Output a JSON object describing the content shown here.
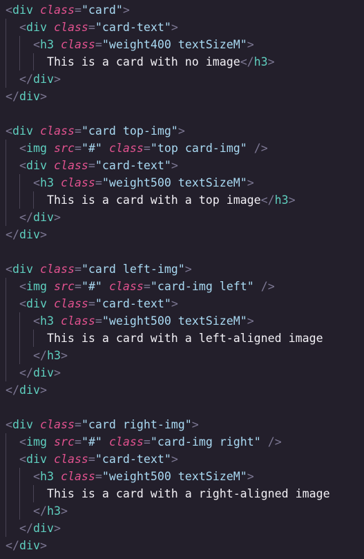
{
  "editor": {
    "colors": {
      "background": "#231f2b",
      "punctuation": "#7d7894",
      "tag": "#5fd0c0",
      "attribute": "#e2528f",
      "string": "#a9d9f2",
      "text": "#f2f0f5"
    },
    "lines": [
      {
        "indent": 0,
        "tokens": [
          [
            "punc",
            "<"
          ],
          [
            "tag",
            "div"
          ],
          [
            "txt",
            " "
          ],
          [
            "attr",
            "class"
          ],
          [
            "eq",
            "="
          ],
          [
            "str",
            "\"card\""
          ],
          [
            "punc",
            ">"
          ]
        ]
      },
      {
        "indent": 1,
        "tokens": [
          [
            "punc",
            "<"
          ],
          [
            "tag",
            "div"
          ],
          [
            "txt",
            " "
          ],
          [
            "attr",
            "class"
          ],
          [
            "eq",
            "="
          ],
          [
            "str",
            "\"card-text\""
          ],
          [
            "punc",
            ">"
          ]
        ]
      },
      {
        "indent": 2,
        "tokens": [
          [
            "punc",
            "<"
          ],
          [
            "tag",
            "h3"
          ],
          [
            "txt",
            " "
          ],
          [
            "attr",
            "class"
          ],
          [
            "eq",
            "="
          ],
          [
            "str",
            "\"weight400 textSizeM\""
          ],
          [
            "punc",
            ">"
          ]
        ]
      },
      {
        "indent": 3,
        "tokens": [
          [
            "txt",
            "This is a card with no image"
          ],
          [
            "punc",
            "</"
          ],
          [
            "tag",
            "h3"
          ],
          [
            "punc",
            ">"
          ]
        ]
      },
      {
        "indent": 1,
        "tokens": [
          [
            "punc",
            "</"
          ],
          [
            "tag",
            "div"
          ],
          [
            "punc",
            ">"
          ]
        ]
      },
      {
        "indent": 0,
        "tokens": [
          [
            "punc",
            "</"
          ],
          [
            "tag",
            "div"
          ],
          [
            "punc",
            ">"
          ]
        ]
      },
      {
        "indent": 0,
        "tokens": []
      },
      {
        "indent": 0,
        "tokens": [
          [
            "punc",
            "<"
          ],
          [
            "tag",
            "div"
          ],
          [
            "txt",
            " "
          ],
          [
            "attr",
            "class"
          ],
          [
            "eq",
            "="
          ],
          [
            "str",
            "\"card top-img\""
          ],
          [
            "punc",
            ">"
          ]
        ]
      },
      {
        "indent": 1,
        "tokens": [
          [
            "punc",
            "<"
          ],
          [
            "tag",
            "img"
          ],
          [
            "txt",
            " "
          ],
          [
            "attr",
            "src"
          ],
          [
            "eq",
            "="
          ],
          [
            "str",
            "\"#\""
          ],
          [
            "txt",
            " "
          ],
          [
            "attr",
            "class"
          ],
          [
            "eq",
            "="
          ],
          [
            "str",
            "\"top card-img\""
          ],
          [
            "txt",
            " "
          ],
          [
            "punc",
            "/>"
          ]
        ]
      },
      {
        "indent": 1,
        "tokens": [
          [
            "punc",
            "<"
          ],
          [
            "tag",
            "div"
          ],
          [
            "txt",
            " "
          ],
          [
            "attr",
            "class"
          ],
          [
            "eq",
            "="
          ],
          [
            "str",
            "\"card-text\""
          ],
          [
            "punc",
            ">"
          ]
        ]
      },
      {
        "indent": 2,
        "tokens": [
          [
            "punc",
            "<"
          ],
          [
            "tag",
            "h3"
          ],
          [
            "txt",
            " "
          ],
          [
            "attr",
            "class"
          ],
          [
            "eq",
            "="
          ],
          [
            "str",
            "\"weight500 textSizeM\""
          ],
          [
            "punc",
            ">"
          ]
        ]
      },
      {
        "indent": 3,
        "tokens": [
          [
            "txt",
            "This is a card with a top image"
          ],
          [
            "punc",
            "</"
          ],
          [
            "tag",
            "h3"
          ],
          [
            "punc",
            ">"
          ]
        ]
      },
      {
        "indent": 1,
        "tokens": [
          [
            "punc",
            "</"
          ],
          [
            "tag",
            "div"
          ],
          [
            "punc",
            ">"
          ]
        ]
      },
      {
        "indent": 0,
        "tokens": [
          [
            "punc",
            "</"
          ],
          [
            "tag",
            "div"
          ],
          [
            "punc",
            ">"
          ]
        ]
      },
      {
        "indent": 0,
        "tokens": []
      },
      {
        "indent": 0,
        "tokens": [
          [
            "punc",
            "<"
          ],
          [
            "tag",
            "div"
          ],
          [
            "txt",
            " "
          ],
          [
            "attr",
            "class"
          ],
          [
            "eq",
            "="
          ],
          [
            "str",
            "\"card left-img\""
          ],
          [
            "punc",
            ">"
          ]
        ]
      },
      {
        "indent": 1,
        "tokens": [
          [
            "punc",
            "<"
          ],
          [
            "tag",
            "img"
          ],
          [
            "txt",
            " "
          ],
          [
            "attr",
            "src"
          ],
          [
            "eq",
            "="
          ],
          [
            "str",
            "\"#\""
          ],
          [
            "txt",
            " "
          ],
          [
            "attr",
            "class"
          ],
          [
            "eq",
            "="
          ],
          [
            "str",
            "\"card-img left\""
          ],
          [
            "txt",
            " "
          ],
          [
            "punc",
            "/>"
          ]
        ]
      },
      {
        "indent": 1,
        "tokens": [
          [
            "punc",
            "<"
          ],
          [
            "tag",
            "div"
          ],
          [
            "txt",
            " "
          ],
          [
            "attr",
            "class"
          ],
          [
            "eq",
            "="
          ],
          [
            "str",
            "\"card-text\""
          ],
          [
            "punc",
            ">"
          ]
        ]
      },
      {
        "indent": 2,
        "tokens": [
          [
            "punc",
            "<"
          ],
          [
            "tag",
            "h3"
          ],
          [
            "txt",
            " "
          ],
          [
            "attr",
            "class"
          ],
          [
            "eq",
            "="
          ],
          [
            "str",
            "\"weight500 textSizeM\""
          ],
          [
            "punc",
            ">"
          ]
        ]
      },
      {
        "indent": 3,
        "tokens": [
          [
            "txt",
            "This is a card with a left-aligned image"
          ]
        ]
      },
      {
        "indent": 2,
        "tokens": [
          [
            "punc",
            "</"
          ],
          [
            "tag",
            "h3"
          ],
          [
            "punc",
            ">"
          ]
        ]
      },
      {
        "indent": 1,
        "tokens": [
          [
            "punc",
            "</"
          ],
          [
            "tag",
            "div"
          ],
          [
            "punc",
            ">"
          ]
        ]
      },
      {
        "indent": 0,
        "tokens": [
          [
            "punc",
            "</"
          ],
          [
            "tag",
            "div"
          ],
          [
            "punc",
            ">"
          ]
        ]
      },
      {
        "indent": 0,
        "tokens": []
      },
      {
        "indent": 0,
        "tokens": [
          [
            "punc",
            "<"
          ],
          [
            "tag",
            "div"
          ],
          [
            "txt",
            " "
          ],
          [
            "attr",
            "class"
          ],
          [
            "eq",
            "="
          ],
          [
            "str",
            "\"card right-img\""
          ],
          [
            "punc",
            ">"
          ]
        ]
      },
      {
        "indent": 1,
        "tokens": [
          [
            "punc",
            "<"
          ],
          [
            "tag",
            "img"
          ],
          [
            "txt",
            " "
          ],
          [
            "attr",
            "src"
          ],
          [
            "eq",
            "="
          ],
          [
            "str",
            "\"#\""
          ],
          [
            "txt",
            " "
          ],
          [
            "attr",
            "class"
          ],
          [
            "eq",
            "="
          ],
          [
            "str",
            "\"card-img right\""
          ],
          [
            "txt",
            " "
          ],
          [
            "punc",
            "/>"
          ]
        ]
      },
      {
        "indent": 1,
        "tokens": [
          [
            "punc",
            "<"
          ],
          [
            "tag",
            "div"
          ],
          [
            "txt",
            " "
          ],
          [
            "attr",
            "class"
          ],
          [
            "eq",
            "="
          ],
          [
            "str",
            "\"card-text\""
          ],
          [
            "punc",
            ">"
          ]
        ]
      },
      {
        "indent": 2,
        "tokens": [
          [
            "punc",
            "<"
          ],
          [
            "tag",
            "h3"
          ],
          [
            "txt",
            " "
          ],
          [
            "attr",
            "class"
          ],
          [
            "eq",
            "="
          ],
          [
            "str",
            "\"weight500 textSizeM\""
          ],
          [
            "punc",
            ">"
          ]
        ]
      },
      {
        "indent": 3,
        "tokens": [
          [
            "txt",
            "This is a card with a right-aligned image"
          ]
        ]
      },
      {
        "indent": 2,
        "tokens": [
          [
            "punc",
            "</"
          ],
          [
            "tag",
            "h3"
          ],
          [
            "punc",
            ">"
          ]
        ]
      },
      {
        "indent": 1,
        "tokens": [
          [
            "punc",
            "</"
          ],
          [
            "tag",
            "div"
          ],
          [
            "punc",
            ">"
          ]
        ]
      },
      {
        "indent": 0,
        "tokens": [
          [
            "punc",
            "</"
          ],
          [
            "tag",
            "div"
          ],
          [
            "punc",
            ">"
          ]
        ]
      }
    ]
  }
}
